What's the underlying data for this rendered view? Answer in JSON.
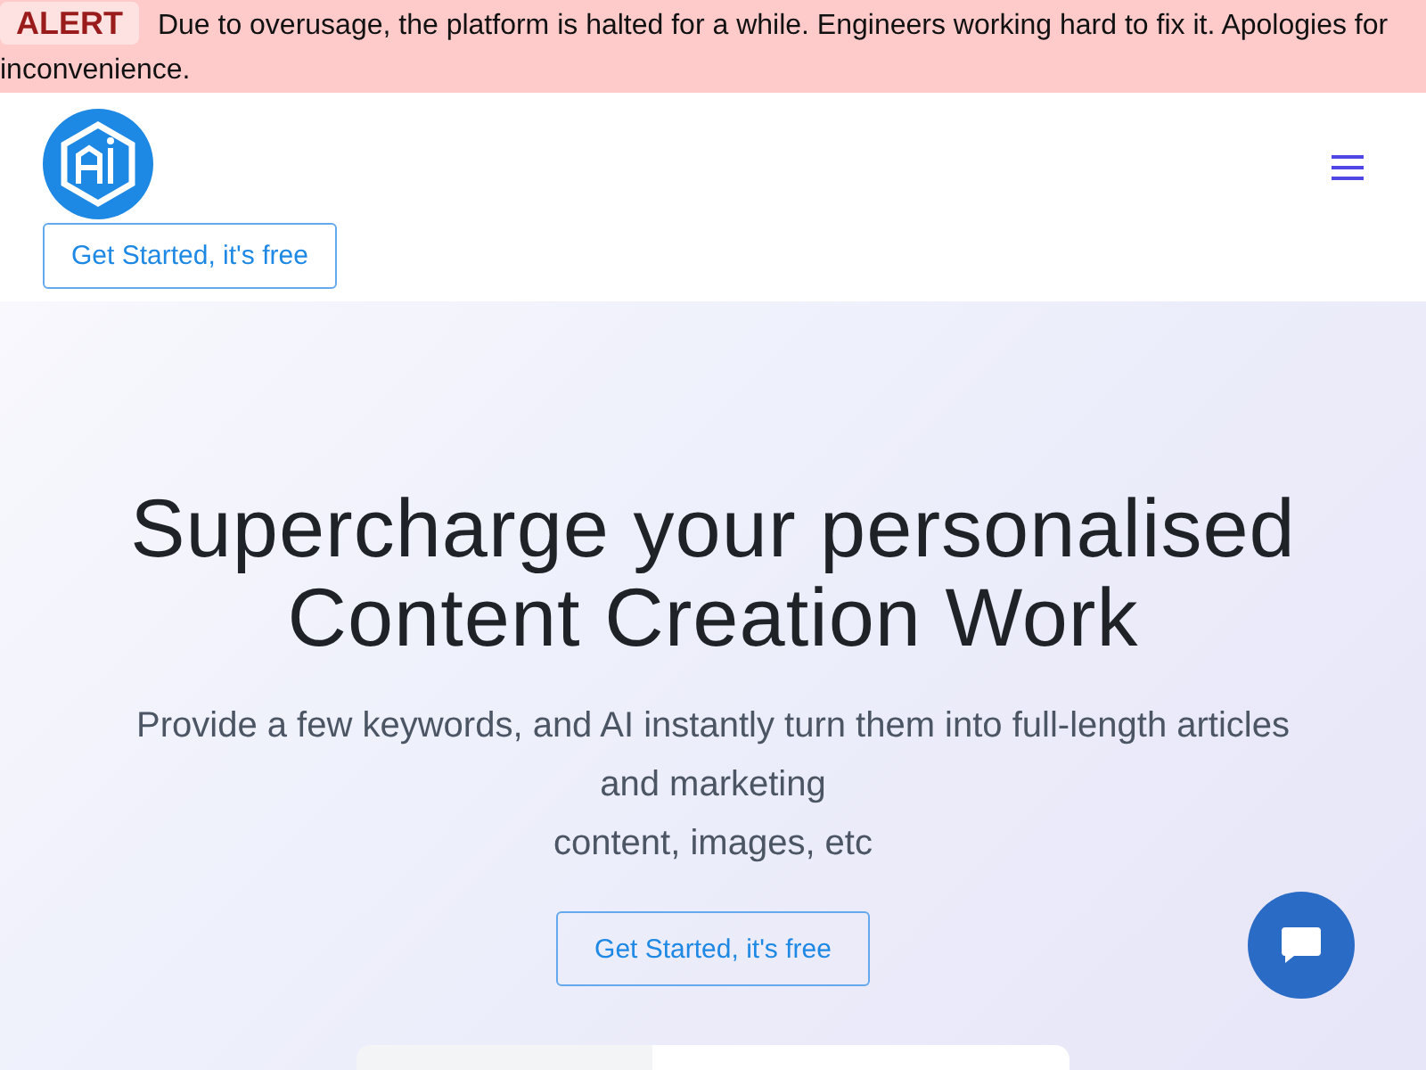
{
  "alert": {
    "message": "**ALERT** Due to overusage, the platform is halted for a while. Engineers working hard to fix it. Apologies for inconvenience."
  },
  "header": {
    "cta": "Get Started, it's free"
  },
  "hero": {
    "title_lines": [
      "Supercharge your personalised",
      "Content Creation Work"
    ],
    "subtitle_lines": [
      "Provide a few keywords, and AI instantly turn them into full-length articles and marketing",
      "content, images, etc"
    ],
    "cta": "Get Started, it's free"
  }
}
